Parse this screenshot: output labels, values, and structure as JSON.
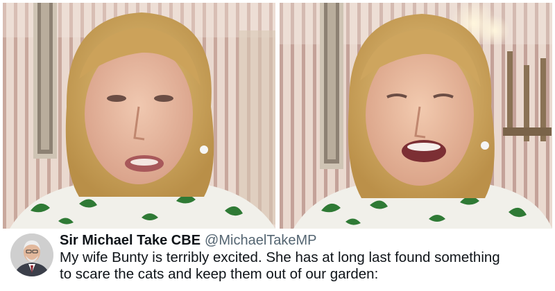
{
  "tweet": {
    "display_name": "Sir Michael Take CBE",
    "handle": "@MichaelTakeMP",
    "text": "My wife Bunty is terribly excited.  She has at long last found something\nto scare the cats and keep them out of our garden:"
  },
  "colors": {
    "wallpaper_stripe_light": "#e9d8cf",
    "wallpaper_stripe_dark": "#b89a92",
    "hair": "#cfa65e",
    "skin": "#e7b9a1",
    "blouse": "#f2f1ea",
    "blouse_pattern": "#2f7a35",
    "text_primary": "#0f1419",
    "text_secondary": "#536471"
  },
  "icons": {
    "avatar": "profile-photo"
  }
}
